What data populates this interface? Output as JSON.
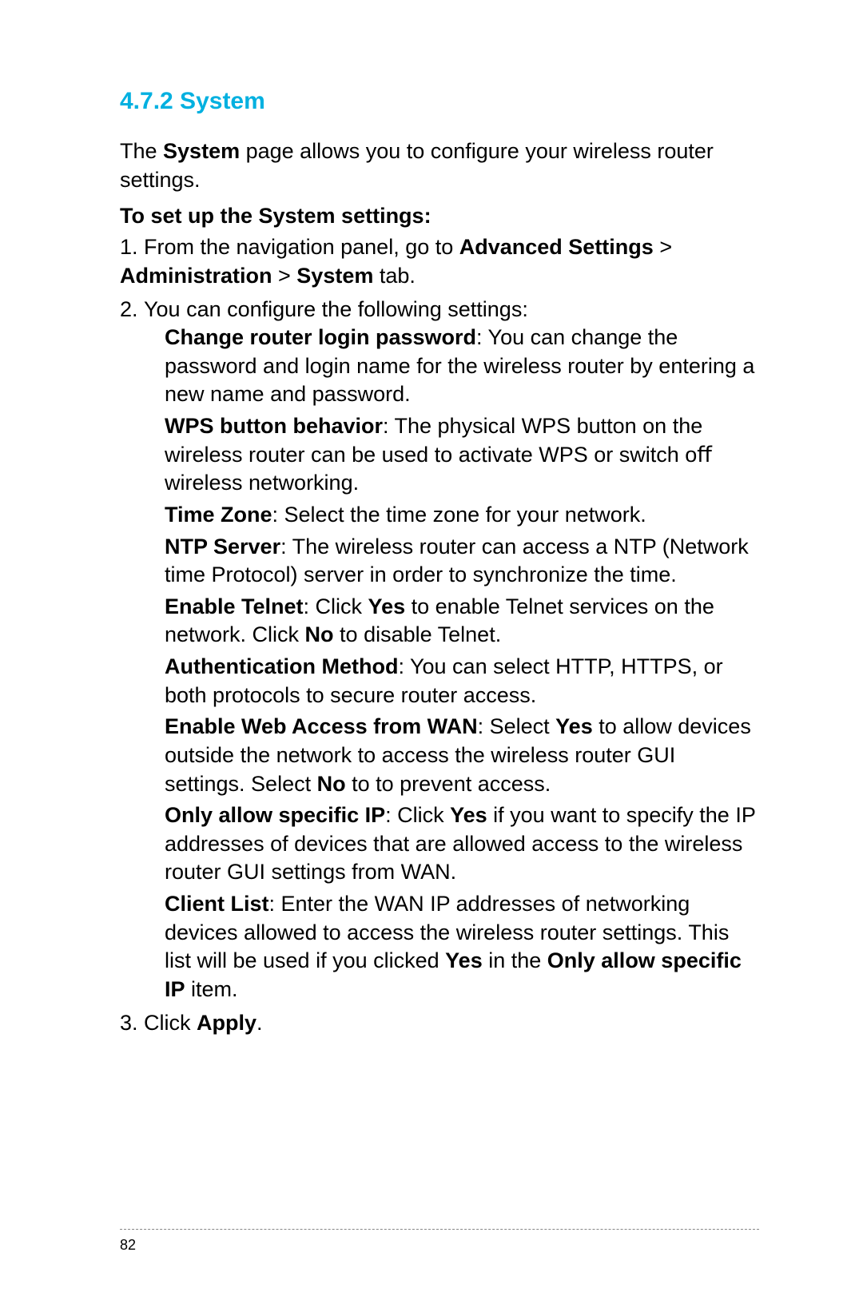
{
  "heading": "4.7.2 System",
  "intro": {
    "pre": "The ",
    "bold": "System",
    "post": " page allows you to conﬁgure your wireless router settings."
  },
  "subheading": "To set up the System settings:",
  "step1": {
    "num": "1.",
    "pre": "From the navigation panel, go to ",
    "b1": "Advanced Settings",
    "gt1": " > ",
    "b2": "Administration",
    "gt2": " > ",
    "b3": "System",
    "post": " tab."
  },
  "step2": {
    "num": "2.",
    "text": "You can conﬁgure the following settings:"
  },
  "bullets": {
    "b1": {
      "label": "Change router login password",
      "post": ":  You can change the password and login name for the wireless router by entering a new name and  password."
    },
    "b2": {
      "label": "WPS button behavior",
      "post": ":  The physical WPS button on the wireless router can be used to activate WPS or switch oﬀ wireless networking."
    },
    "b3": {
      "label": "Time Zone",
      "post": ":  Select the time zone for your network."
    },
    "b4": {
      "label": "NTP Server",
      "post": ":  The wireless router can access a NTP (Network time Protocol) server in order to synchronize the time."
    },
    "b5": {
      "label": "Enable Telnet",
      "pre": ":  Click ",
      "yes": "Yes",
      "mid": " to enable Telnet services on the network. Click ",
      "no": "No",
      "post": " to disable Telnet."
    },
    "b6": {
      "label": "Authentication Method",
      "post": ":  You can select HTTP, HTTPS, or both protocols to secure router access."
    },
    "b7": {
      "label": "Enable Web Access from WAN",
      "pre": ":  Select ",
      "yes": "Yes",
      "mid": " to allow devices outside the network to access the wireless router GUI settings. Select ",
      "no": "No",
      "post": " to to prevent access."
    },
    "b8": {
      "label": "Only allow speciﬁc IP",
      "pre": ":  Click ",
      "yes": "Yes",
      "post": " if you want to specify the IP addresses of devices that are allowed access to the wireless router GUI settings from WAN."
    },
    "b9": {
      "label": "Client List",
      "pre": ":  Enter the WAN IP addresses of networking devices allowed to access the wireless router settings. This list will be used if you clicked ",
      "yes": "Yes",
      "mid": " in the ",
      "b2": "Only allow speciﬁc IP",
      "post": " item."
    }
  },
  "step3": {
    "num": "3.",
    "pre": "Click ",
    "b": "Apply",
    "post": "."
  },
  "pagenum": "82"
}
